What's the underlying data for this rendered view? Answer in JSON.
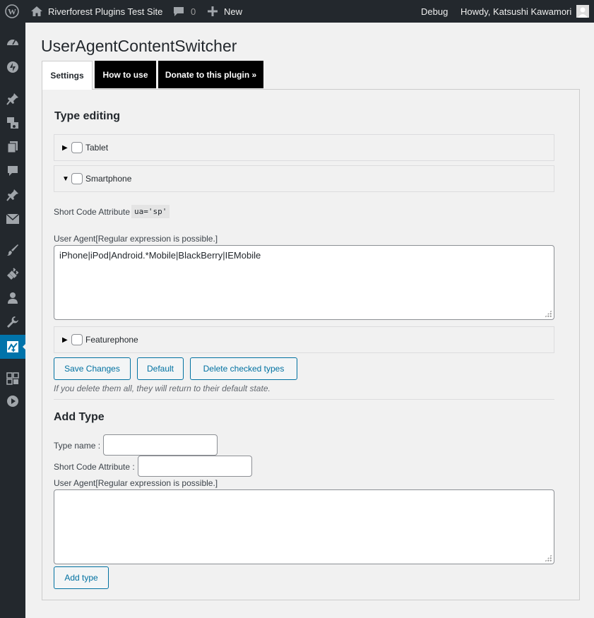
{
  "adminbar": {
    "site_name": "Riverforest Plugins Test Site",
    "comments_count": "0",
    "new_label": "New",
    "debug_label": "Debug",
    "howdy": "Howdy, Katsushi Kawamori",
    "icons": [
      "wordpress-logo-icon",
      "home-icon",
      "comment-bubble-icon",
      "plus-icon",
      "user-avatar-icon"
    ]
  },
  "sidebar": {
    "icons": [
      "dashboard-icon",
      "jetpack-icon",
      "posts-pin-icon",
      "media-icon",
      "pages-icon",
      "comments-icon",
      "pin-icon",
      "mail-icon",
      "appearance-brush-icon",
      "plugins-icon",
      "users-icon",
      "tools-wrench-icon",
      "settings-switcher-icon",
      "grid-icon",
      "play-icon"
    ]
  },
  "page": {
    "title": "UserAgentContentSwitcher",
    "tabs": [
      "Settings",
      "How to use",
      "Donate to this plugin »"
    ]
  },
  "type_editing": {
    "heading": "Type editing",
    "types": [
      {
        "label": "Tablet",
        "expanded": false
      },
      {
        "label": "Smartphone",
        "expanded": true
      },
      {
        "label": "Featurephone",
        "expanded": false
      }
    ],
    "shortcode_label": "Short Code Attribute",
    "shortcode_value": "ua='sp'",
    "useragent_label": "User Agent[Regular expression is possible.]",
    "useragent_value": "iPhone|iPod|Android.*Mobile|BlackBerry|IEMobile",
    "buttons": [
      "Save Changes",
      "Default",
      "Delete checked types"
    ],
    "note": "If you delete them all, they will return to their default state."
  },
  "add_type": {
    "heading": "Add Type",
    "type_name_label": "Type name :",
    "shortcode_label": "Short Code Attribute :",
    "useragent_label": "User Agent[Regular expression is possible.]",
    "button": "Add type"
  },
  "colors": {
    "admin_bar": "#23282d",
    "accent": "#0073aa",
    "button_text": "#0071a1"
  }
}
